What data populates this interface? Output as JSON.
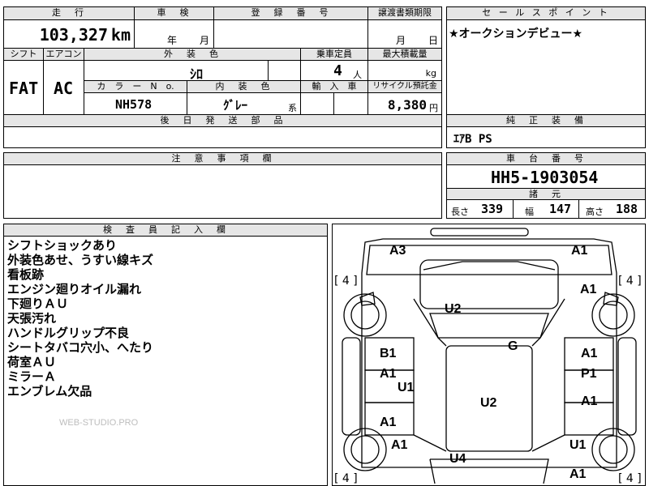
{
  "headers": {
    "mileage": "走　行",
    "inspection": "車　検",
    "registration": "登　録　番　号",
    "transfer_deadline": "譲渡書類期限",
    "sales_point": "セ ー ル ス ポ イ ン ト",
    "shift": "シフト",
    "aircon": "エアコン",
    "exterior_color": "外　装　色",
    "capacity": "乗車定員",
    "max_load": "最大積載量",
    "color_no": "カ　ラ　ー　N　o.",
    "interior_color": "内　装　色",
    "import": "輸　入　車",
    "recycle_fee": "リサイクル預託金",
    "later_parts": "後　日　発　送　部　品",
    "genuine_equip": "純　正　装　備",
    "notes": "注　意　事　項　欄",
    "chassis_no": "車　台　番　号",
    "specs": "諸　元",
    "inspector": "検　査　員　記　入　欄"
  },
  "values": {
    "mileage": "103,327",
    "mileage_unit": "km",
    "inspection_year": "年",
    "inspection_month": "月",
    "transfer_month": "月",
    "transfer_day": "日",
    "sales_point_text": "★オークションデビュー★",
    "shift": "FAT",
    "aircon": "AC",
    "exterior_color": "ｼﾛ",
    "capacity": "4",
    "capacity_unit": "人",
    "max_load_unit": "kg",
    "color_no": "NH578",
    "interior_color": "ｸﾞﾚｰ",
    "interior_suffix": "系",
    "recycle_fee": "8,380",
    "recycle_unit": "円",
    "genuine_equip": "ｴｱB  PS",
    "chassis_no": "HH5-1903054",
    "length_label": "長さ",
    "length": "339",
    "width_label": "幅",
    "width": "147",
    "height_label": "高さ",
    "height": "188"
  },
  "inspector_notes": [
    "シフトショックあり",
    "外装色あせ、うすい線キズ",
    "看板跡",
    "エンジン廻りオイル漏れ",
    "下廻りＡＵ",
    "天張汚れ",
    "ハンドルグリップ不良",
    "シートタバコ穴小、へたり",
    "荷室ＡＵ",
    "ミラーＡ",
    "エンブレム欠品"
  ],
  "watermark": "WEB-STUDIO.PRO",
  "diagram": {
    "tire_marks": [
      "[ 4 ]",
      "[ 4 ]",
      "[ 4 ]",
      "[ 4 ]"
    ],
    "marks": [
      "A3",
      "A1",
      "A1",
      "U2",
      "G",
      "B1",
      "A1",
      "A1",
      "P1",
      "U1",
      "U2",
      "A1",
      "A1",
      "A1",
      "U1",
      "U4",
      "A1"
    ]
  }
}
